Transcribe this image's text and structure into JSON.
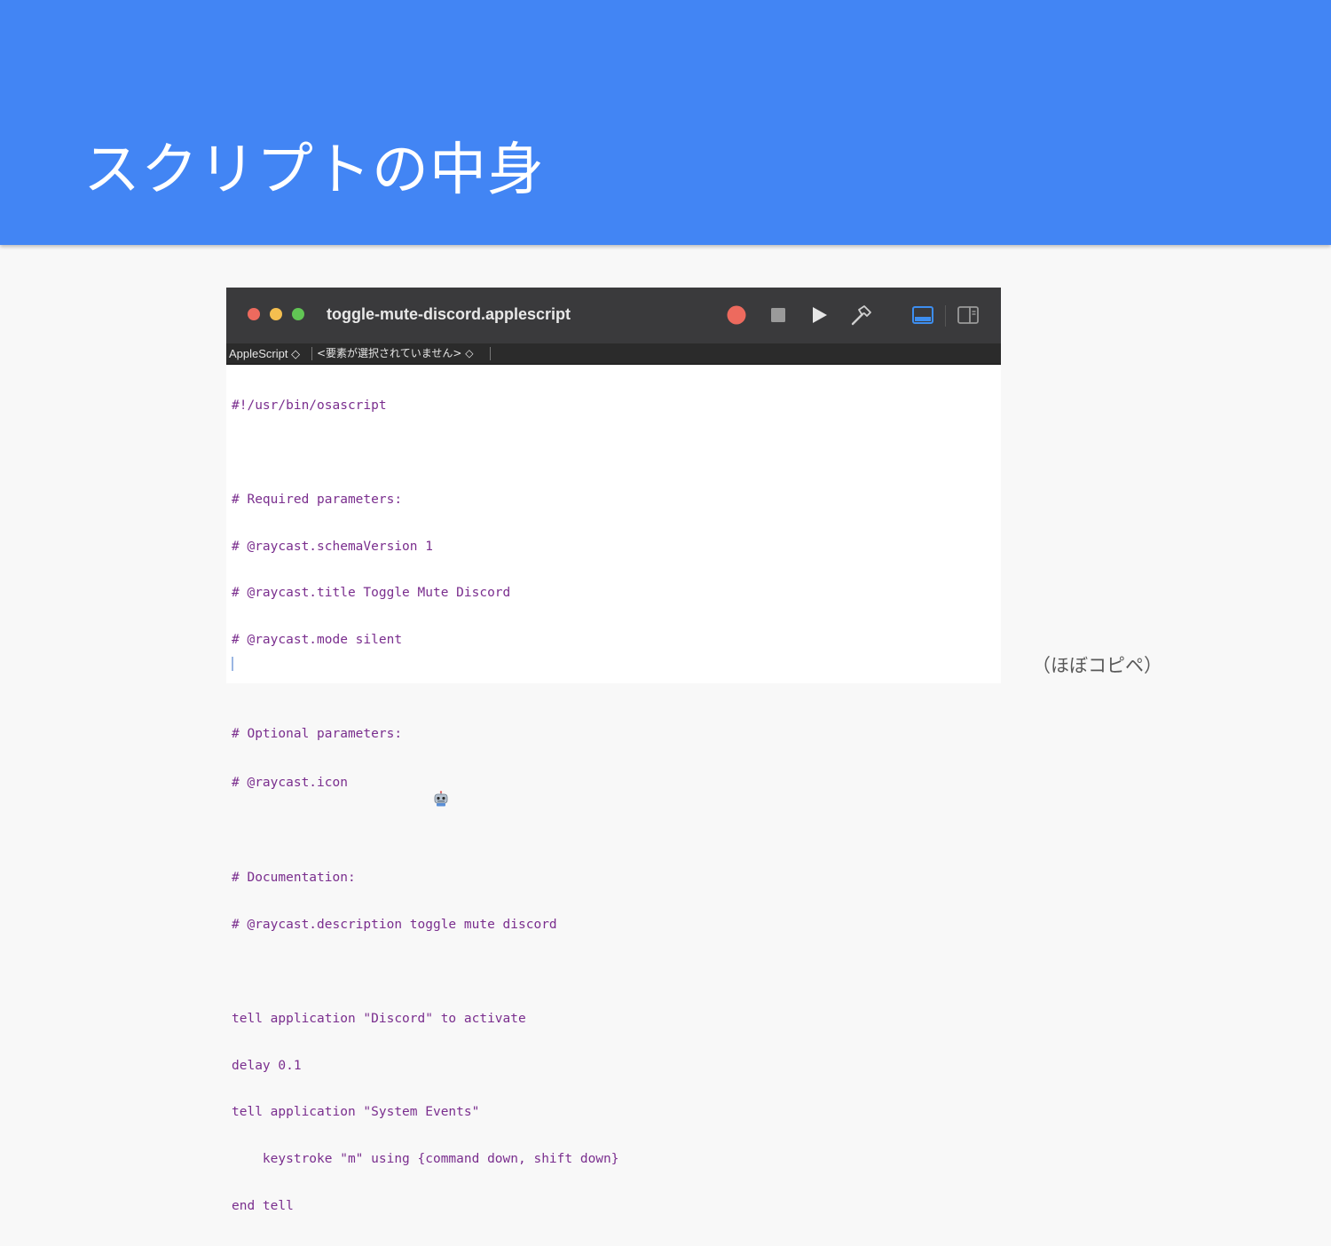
{
  "slide": {
    "title": "スクリプトの中身",
    "note": "（ほぼコピペ）"
  },
  "window": {
    "filename": "toggle-mute-discord.applescript",
    "toolbar_icons": [
      "record-icon",
      "stop-icon",
      "run-icon",
      "compile-hammer-icon",
      "log-panel-icon",
      "sidebar-panel-icon"
    ],
    "colors": {
      "titlebar": "#3a3a3c",
      "record": "#ed6a5e",
      "accent": "#3d8ef0",
      "code_text": "#7a2e8e"
    }
  },
  "navigator": {
    "language": "AppleScript ◇",
    "element": "<要素が選択されていません> ◇"
  },
  "editor": {
    "lines": [
      "#!/usr/bin/osascript",
      "",
      "# Required parameters:",
      "# @raycast.schemaVersion 1",
      "# @raycast.title Toggle Mute Discord",
      "# @raycast.mode silent",
      "",
      "# Optional parameters:",
      "# @raycast.icon",
      "",
      "# Documentation:",
      "# @raycast.description toggle mute discord",
      "",
      "tell application \"Discord\" to activate",
      "delay 0.1",
      "tell application \"System Events\"",
      "    keystroke \"m\" using {command down, shift down}",
      "end tell"
    ],
    "icon_emoji": "robot-icon"
  }
}
